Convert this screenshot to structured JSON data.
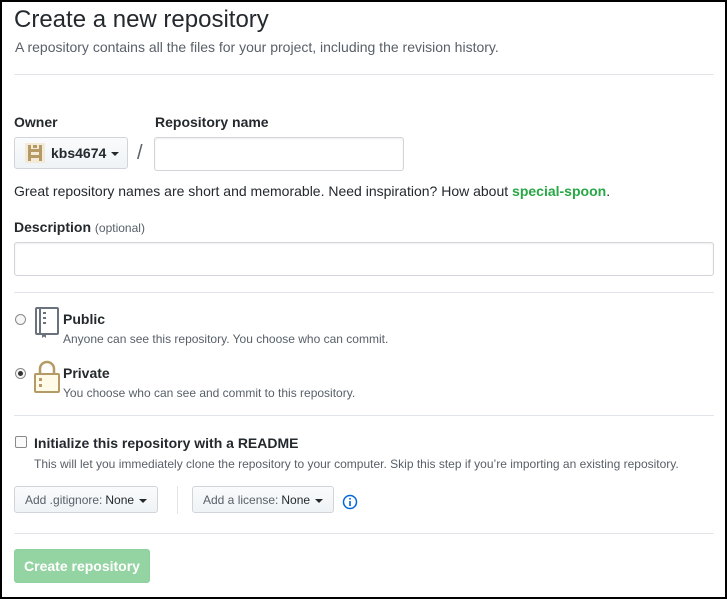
{
  "header": {
    "title": "Create a new repository",
    "subtitle": "A repository contains all the files for your project, including the revision history."
  },
  "owner": {
    "label": "Owner",
    "value": "kbs4674",
    "avatar_icon": "user-avatar-icon"
  },
  "separator": "/",
  "repo_name": {
    "label": "Repository name",
    "value": "",
    "placeholder": ""
  },
  "name_hint": {
    "prefix": "Great repository names are short and memorable. Need inspiration? How about ",
    "suggestion": "special-spoon",
    "suffix": "."
  },
  "description": {
    "label": "Description",
    "optional": "(optional)",
    "value": ""
  },
  "visibility": {
    "selected": "private",
    "options": [
      {
        "id": "public",
        "title": "Public",
        "desc": "Anyone can see this repository. You choose who can commit.",
        "icon": "repo-book-icon"
      },
      {
        "id": "private",
        "title": "Private",
        "desc": "You choose who can see and commit to this repository.",
        "icon": "lock-icon"
      }
    ]
  },
  "readme": {
    "checked": false,
    "title": "Initialize this repository with a README",
    "desc": "This will let you immediately clone the repository to your computer. Skip this step if you’re importing an existing repository."
  },
  "gitignore": {
    "label": "Add .gitignore:",
    "value": "None"
  },
  "license": {
    "label": "Add a license:",
    "value": "None"
  },
  "info_icon": "info-icon",
  "submit": {
    "label": "Create repository",
    "disabled": true
  },
  "colors": {
    "accent_green": "#28a745",
    "disabled_button": "#94d3a2",
    "icon_gold": "#b59a66",
    "info_blue": "#0366d6"
  }
}
